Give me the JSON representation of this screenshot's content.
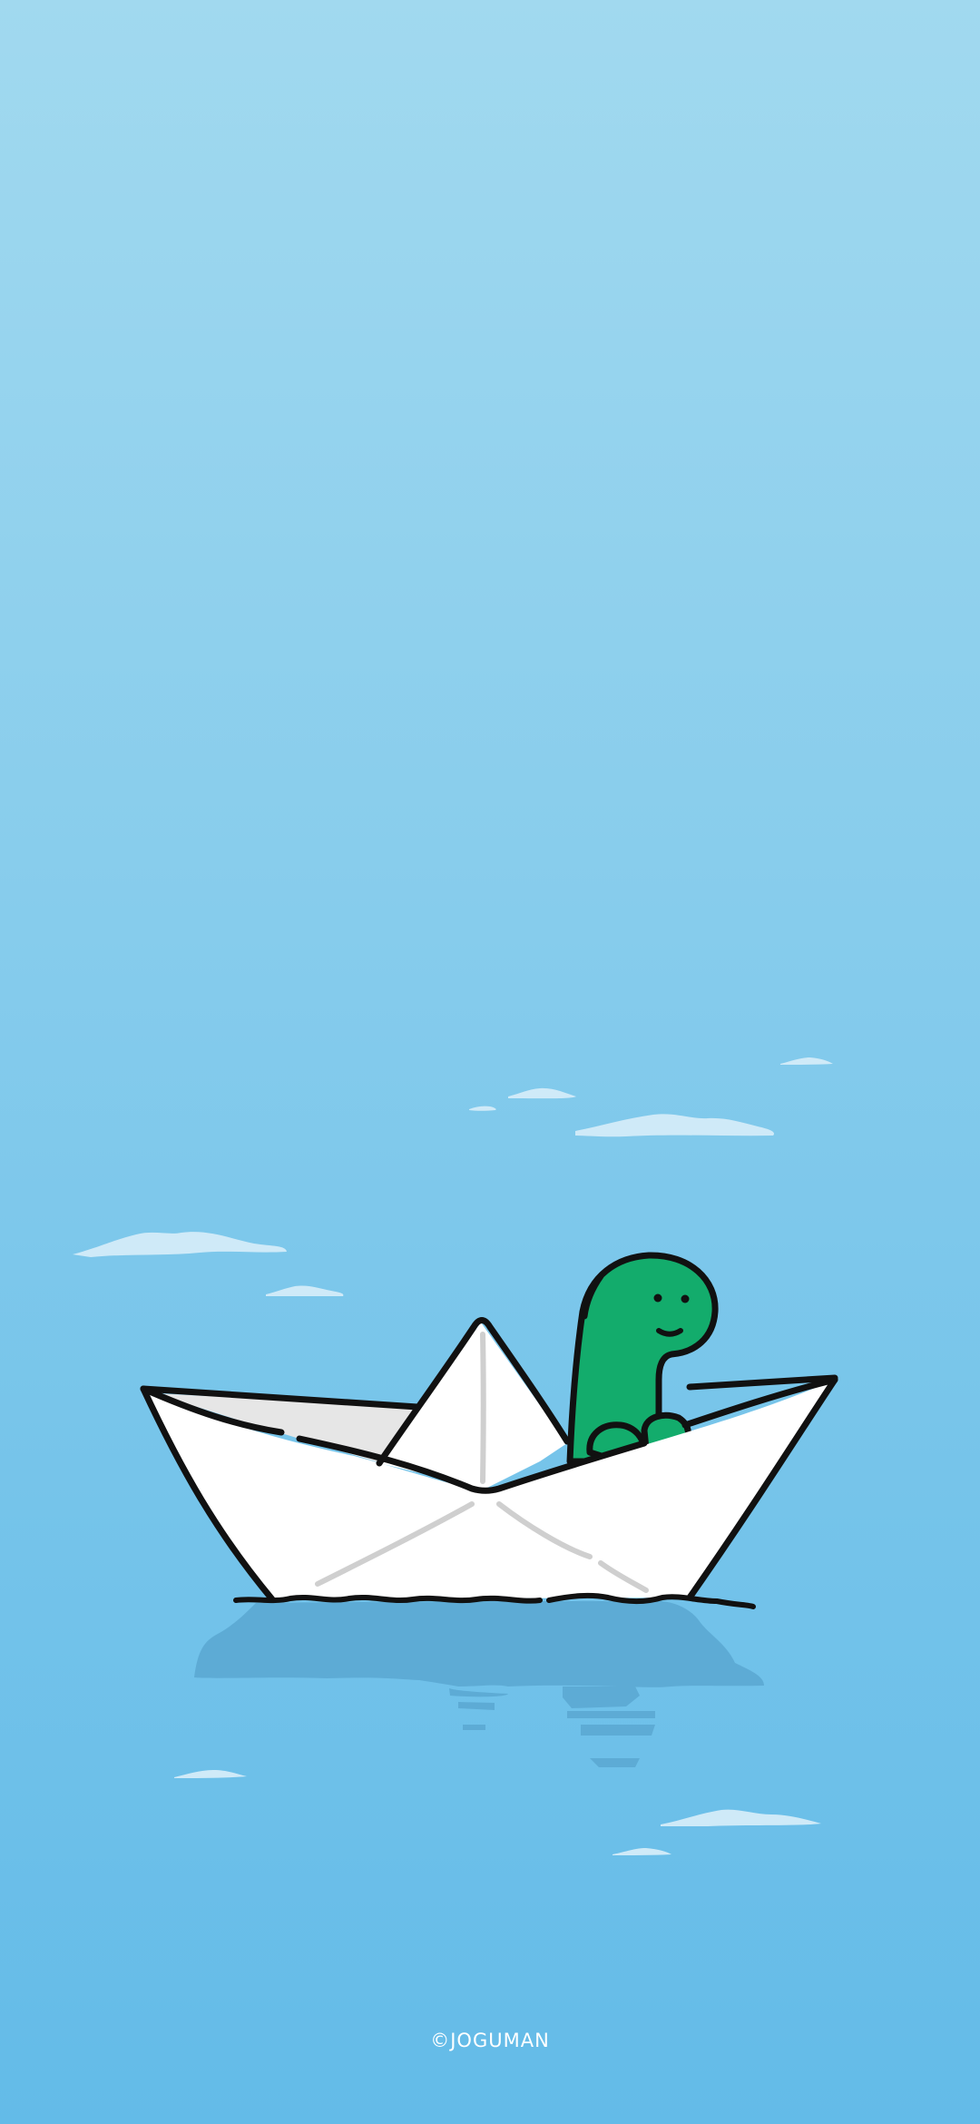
{
  "illustration": {
    "subject": "paper-boat-with-green-dinosaur",
    "colors": {
      "sky_top": "#a1d9ef",
      "sky_bottom": "#63bbe8",
      "dino_green": "#13ac6c",
      "boat_white": "#ffffff",
      "boat_shadow": "#e6e6e6",
      "fold_gray": "#cfcfcf",
      "reflection": "#5dabd5",
      "cloud_white": "#cfeaf8",
      "outline": "#111111"
    }
  },
  "credit": {
    "text": "©JOGUMAN"
  }
}
